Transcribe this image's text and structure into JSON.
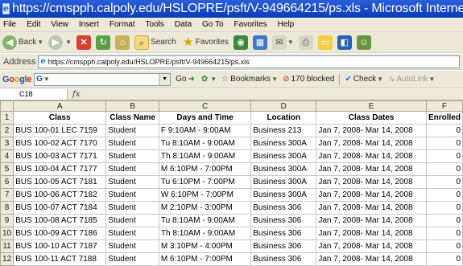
{
  "window": {
    "title": "https://cmspph.calpoly.edu/HSLOPRE/psft/V-949664215/ps.xls - Microsoft Internet Explorer"
  },
  "menu": [
    "File",
    "Edit",
    "View",
    "Insert",
    "Format",
    "Tools",
    "Data",
    "Go To",
    "Favorites",
    "Help"
  ],
  "toolbar": {
    "back_label": "Back",
    "search_label": "Search",
    "favorites_label": "Favorites"
  },
  "address": {
    "label": "Address",
    "url": "https://cmspph.calpoly.edu/HSLOPRE/psft/V-949664215/ps.xls"
  },
  "google_bar": {
    "go_label": "Go",
    "bookmarks_label": "Bookmarks",
    "blocked_label": "170 blocked",
    "check_label": "Check",
    "autolink_label": "AutoLink"
  },
  "formula_bar": {
    "cell_ref": "C18",
    "fx": "fx"
  },
  "sheet": {
    "columns": [
      "A",
      "B",
      "C",
      "D",
      "E",
      "F"
    ],
    "headers": [
      "Class",
      "Class Name",
      "Days and Time",
      "Location",
      "Class Dates",
      "Enrolled"
    ],
    "rows": [
      [
        "BUS 100-01 LEC 7159",
        "Student",
        "F 9:10AM - 9:00AM",
        "Business 213",
        "Jan 7, 2008- Mar 14, 2008",
        "0"
      ],
      [
        "BUS 100-02 ACT 7170",
        "Student",
        "Tu 8:10AM - 9:00AM",
        "Business 300A",
        "Jan 7, 2008- Mar 14, 2008",
        "0"
      ],
      [
        "BUS 100-03 ACT 7171",
        "Student",
        "Th 8:10AM - 9:00AM",
        "Business 300A",
        "Jan 7, 2008- Mar 14, 2008",
        "0"
      ],
      [
        "BUS 100-04 ACT 7177",
        "Student",
        "M 6:10PM - 7:00PM",
        "Business 300A",
        "Jan 7, 2008- Mar 14, 2008",
        "0"
      ],
      [
        "BUS 100-05 ACT 7181",
        "Student",
        "Tu 6:10PM - 7:00PM",
        "Business 300A",
        "Jan 7, 2008- Mar 14, 2008",
        "0"
      ],
      [
        "BUS 100-06 ACT 7182",
        "Student",
        "W 6:10PM - 7:00PM",
        "Business 300A",
        "Jan 7, 2008- Mar 14, 2008",
        "0"
      ],
      [
        "BUS 100-07 ACT 7184",
        "Student",
        "M 2:10PM - 3:00PM",
        "Business 306",
        "Jan 7, 2008- Mar 14, 2008",
        "0"
      ],
      [
        "BUS 100-08 ACT 7185",
        "Student",
        "Tu 8:10AM - 9:00AM",
        "Business 306",
        "Jan 7, 2008- Mar 14, 2008",
        "0"
      ],
      [
        "BUS 100-09 ACT 7186",
        "Student",
        "Th 8:10AM - 9:00AM",
        "Business 306",
        "Jan 7, 2008- Mar 14, 2008",
        "0"
      ],
      [
        "BUS 100-10 ACT 7187",
        "Student",
        "M 3:10PM - 4:00PM",
        "Business 306",
        "Jan 7, 2008- Mar 14, 2008",
        "0"
      ],
      [
        "BUS 100-11 ACT 7188",
        "Student",
        "M 6:10PM - 7:00PM",
        "Business 306",
        "Jan 7, 2008- Mar 14, 2008",
        "0"
      ]
    ]
  }
}
